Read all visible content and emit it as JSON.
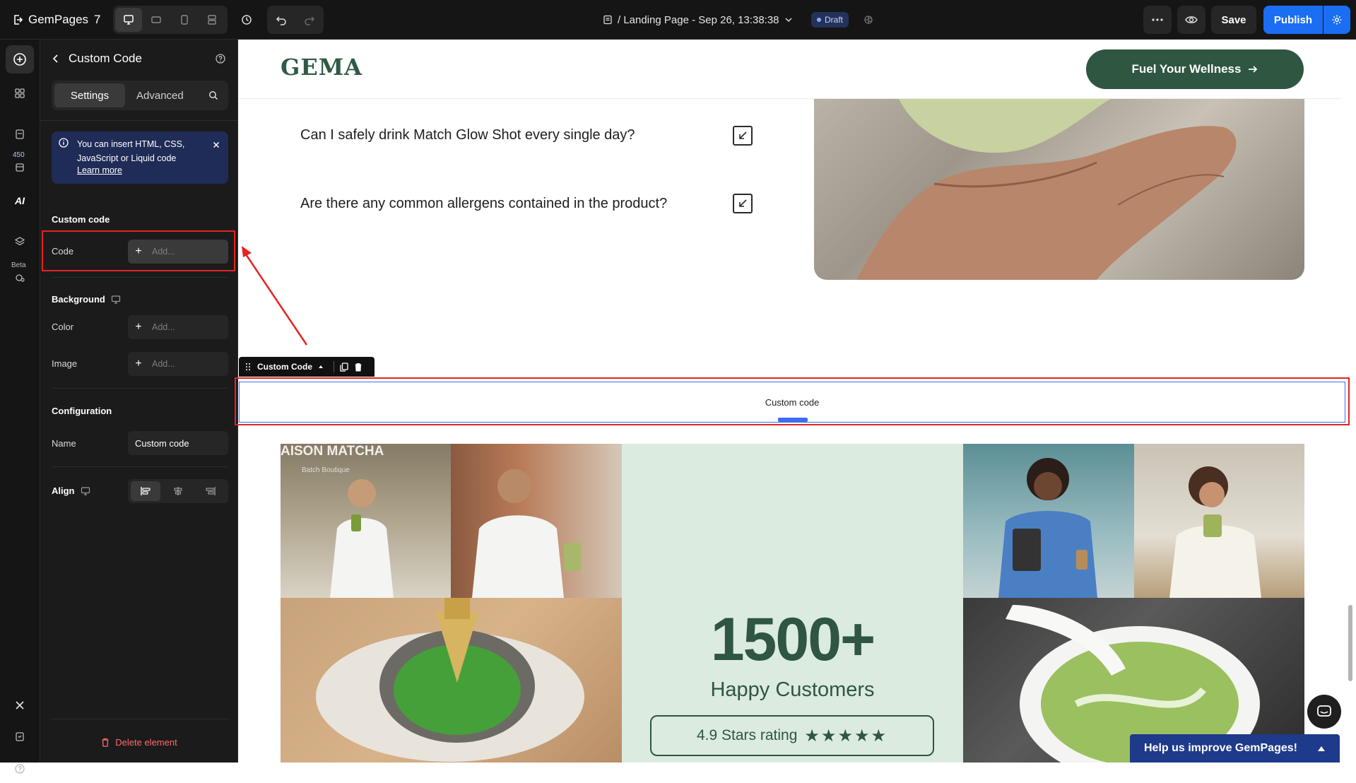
{
  "topbar": {
    "app_name": "GemPages",
    "app_version": "7",
    "page_title": "/ Landing Page - Sep 26, 13:38:38",
    "status": "Draft",
    "save_label": "Save",
    "publish_label": "Publish"
  },
  "rail": {
    "badge_count": "450",
    "ai_label": "AI",
    "beta_label": "Beta"
  },
  "panel": {
    "title": "Custom Code",
    "tabs": [
      "Settings",
      "Advanced"
    ],
    "info": {
      "text": "You can insert HTML, CSS, JavaScript or Liquid code",
      "link": "Learn more"
    },
    "custom_code": {
      "section_title": "Custom code",
      "code_label": "Code",
      "code_placeholder": "Add..."
    },
    "background": {
      "section_title": "Background",
      "color_label": "Color",
      "color_placeholder": "Add...",
      "image_label": "Image",
      "image_placeholder": "Add..."
    },
    "configuration": {
      "section_title": "Configuration",
      "name_label": "Name",
      "name_value": "Custom code"
    },
    "align": {
      "section_title": "Align"
    },
    "delete_label": "Delete element"
  },
  "canvas": {
    "logo_text": "GEMA",
    "cta_label": "Fuel Your Wellness",
    "faq": [
      "Can I safely drink Match Glow Shot every single day?",
      "Are there any common allergens contained in the product?"
    ],
    "toolbar_label": "Custom Code",
    "custom_code_placeholder": "Custom code",
    "stat_number": "1500+",
    "stat_label": "Happy Customers",
    "rating_text": "4.9 Stars rating",
    "rating_stars": "★★★★★",
    "rating_value": 4.9,
    "help_label": "Help us improve GemPages!",
    "store_sign": "AISON MATCHA",
    "store_subsign": "Batch Boutique"
  },
  "colors": {
    "brand_green": "#2e5641",
    "publish_blue": "#1b6ef3",
    "highlight_red": "#e52323",
    "selection_blue": "#3f6cf0",
    "panel_bg": "#1b1b1b"
  }
}
